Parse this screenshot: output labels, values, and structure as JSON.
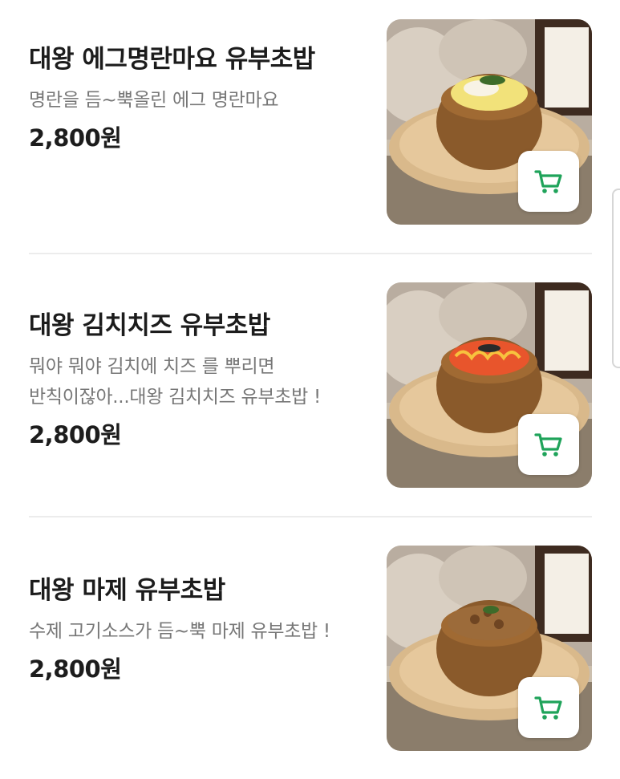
{
  "colors": {
    "cart_green": "#1fa35a",
    "text_primary": "#1c1c1c",
    "text_secondary": "#777777",
    "divider": "#ececec"
  },
  "menu": {
    "items": [
      {
        "name": "대왕 에그명란마요 유부초밥",
        "description": "명란을 듬~뿍올린 에그 명란마요",
        "price": "2,800원",
        "image": "egg-myeongran-mayo-yubuchobap-photo",
        "topping_color": "#f2e27a",
        "icon": "cart-icon"
      },
      {
        "name": "대왕 김치치즈 유부초밥",
        "description": "뭐야 뭐야 김치에 치즈 를 뿌리면 반칙이잖아...대왕 김치치즈 유부초밥 !",
        "price": "2,800원",
        "image": "kimchi-cheese-yubuchobap-photo",
        "topping_color": "#e8552c",
        "icon": "cart-icon"
      },
      {
        "name": "대왕 마제 유부초밥",
        "description": "수제 고기소스가 듬~뿍 마제 유부초밥 !",
        "price": "2,800원",
        "image": "maze-yubuchobap-photo",
        "topping_color": "#9c6b3a",
        "icon": "cart-icon"
      }
    ]
  }
}
